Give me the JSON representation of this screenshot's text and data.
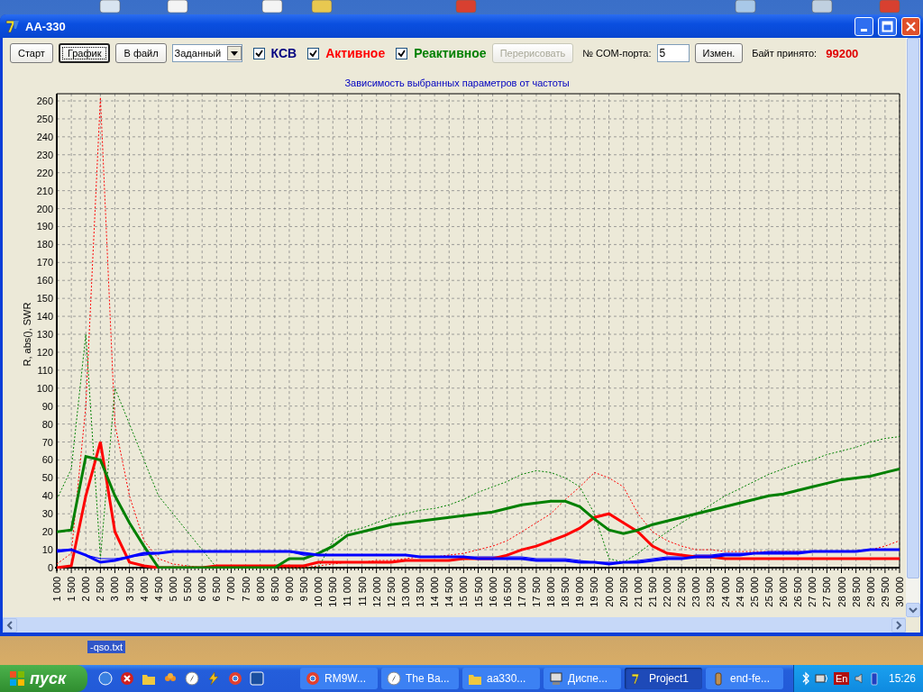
{
  "window": {
    "title": "AA-330"
  },
  "toolbar": {
    "items": [
      {
        "kind": "button",
        "label": "Старт",
        "focused": false,
        "disabled": false
      },
      {
        "kind": "button",
        "label": "График",
        "focused": true,
        "disabled": false
      },
      {
        "kind": "button",
        "label": "В файл",
        "focused": false,
        "disabled": false
      },
      {
        "kind": "dropdown",
        "value": "Заданный"
      },
      {
        "kind": "checkbox",
        "label": "КСВ",
        "checked": true,
        "color": "#000080"
      },
      {
        "kind": "checkbox",
        "label": "Активное",
        "checked": true,
        "color": "#ff0000"
      },
      {
        "kind": "checkbox",
        "label": "Реактивное",
        "checked": true,
        "color": "#008000"
      },
      {
        "kind": "button",
        "label": "Перерисовать",
        "focused": false,
        "disabled": true
      },
      {
        "kind": "label",
        "text": "№ COM-порта:"
      },
      {
        "kind": "input",
        "value": "5"
      },
      {
        "kind": "button",
        "label": "Измен.",
        "focused": false,
        "disabled": false
      },
      {
        "kind": "label",
        "text": "Байт принято:"
      },
      {
        "kind": "value",
        "text": "99200"
      }
    ]
  },
  "chart": {
    "chart_data": {
      "type": "line",
      "title": "Зависимость выбранных параметров от частоты",
      "ylabel": "R, abs(), SWR",
      "categories": [
        "1 000",
        "1 500",
        "2 000",
        "2 500",
        "3 000",
        "3 500",
        "4 000",
        "4 500",
        "5 000",
        "5 500",
        "6 000",
        "6 500",
        "7 000",
        "7 500",
        "8 000",
        "8 500",
        "9 000",
        "9 500",
        "10 000",
        "10 500",
        "11 000",
        "11 500",
        "12 000",
        "12 500",
        "13 000",
        "13 500",
        "14 000",
        "14 500",
        "15 000",
        "15 500",
        "16 000",
        "16 500",
        "17 000",
        "17 500",
        "18 000",
        "18 500",
        "19 000",
        "19 500",
        "20 000",
        "20 500",
        "21 000",
        "21 500",
        "22 000",
        "22 500",
        "23 000",
        "23 500",
        "24 000",
        "24 500",
        "25 000",
        "25 500",
        "26 000",
        "26 500",
        "27 000",
        "27 500",
        "28 000",
        "28 500",
        "29 000",
        "29 500",
        "30 000"
      ],
      "ylim": [
        0,
        264
      ],
      "grid": true,
      "yticks": [
        0,
        10,
        20,
        30,
        40,
        50,
        60,
        70,
        80,
        90,
        100,
        110,
        120,
        130,
        140,
        150,
        160,
        170,
        180,
        190,
        200,
        210,
        220,
        230,
        240,
        250,
        260
      ],
      "series": [
        {
          "line_style": "dashed",
          "color": "#ff0000",
          "values": [
            2,
            8,
            90,
            262,
            80,
            40,
            15,
            5,
            2,
            1,
            0,
            0,
            0,
            0,
            0,
            0,
            0,
            0,
            1,
            2,
            3,
            3,
            4,
            4,
            5,
            6,
            6,
            7,
            8,
            10,
            12,
            15,
            20,
            25,
            30,
            38,
            45,
            53,
            50,
            45,
            30,
            20,
            15,
            12,
            10,
            10,
            9,
            9,
            9,
            9,
            9,
            9,
            9,
            9,
            9,
            9,
            10,
            12,
            15
          ]
        },
        {
          "line_style": "dashed",
          "color": "#008000",
          "values": [
            38,
            55,
            130,
            5,
            100,
            80,
            60,
            40,
            30,
            20,
            10,
            0,
            0,
            0,
            0,
            0,
            0,
            0,
            0,
            15,
            20,
            22,
            25,
            28,
            30,
            32,
            33,
            35,
            38,
            42,
            45,
            48,
            52,
            54,
            53,
            50,
            45,
            30,
            5,
            3,
            8,
            14,
            20,
            25,
            30,
            35,
            40,
            44,
            48,
            52,
            55,
            58,
            60,
            63,
            65,
            67,
            70,
            72,
            73
          ]
        },
        {
          "line_style": "solid",
          "color": "#0000ff",
          "values": [
            10,
            10,
            7,
            5,
            5,
            6,
            7,
            8,
            9,
            9,
            9,
            9,
            9,
            9,
            9,
            9,
            9,
            7,
            7,
            7,
            7,
            7,
            7,
            7,
            7,
            6,
            6,
            6,
            6,
            6,
            6,
            6,
            6,
            5,
            5,
            5,
            4,
            3,
            3,
            3,
            4,
            5,
            6,
            6,
            7,
            7,
            8,
            8,
            8,
            9,
            9,
            9,
            9,
            9,
            9,
            9,
            10,
            10,
            10
          ]
        },
        {
          "line_style": "solid",
          "color": "#ff0000",
          "values": [
            0,
            1,
            40,
            70,
            20,
            3,
            1,
            0,
            0,
            0,
            0,
            1,
            1,
            1,
            1,
            1,
            1,
            1,
            3,
            3,
            3,
            3,
            3,
            3,
            4,
            4,
            4,
            4,
            5,
            5,
            5,
            7,
            10,
            12,
            15,
            18,
            22,
            28,
            30,
            25,
            20,
            12,
            8,
            7,
            6,
            6,
            5,
            5,
            5,
            5,
            5,
            5,
            5,
            5,
            5,
            5,
            5,
            5,
            5
          ]
        },
        {
          "line_style": "solid",
          "color": "#008000",
          "values": [
            20,
            21,
            62,
            60,
            40,
            25,
            12,
            0,
            0,
            0,
            0,
            0,
            0,
            0,
            0,
            0,
            5,
            5,
            8,
            12,
            18,
            20,
            22,
            24,
            25,
            26,
            27,
            28,
            29,
            30,
            31,
            33,
            35,
            36,
            37,
            37,
            34,
            27,
            21,
            19,
            21,
            24,
            26,
            28,
            30,
            32,
            34,
            36,
            38,
            40,
            41,
            43,
            45,
            47,
            49,
            50,
            51,
            53,
            55
          ]
        },
        {
          "line_style": "solid",
          "color": "#0000ff",
          "values": [
            9,
            10,
            7,
            3,
            4,
            6,
            8,
            8,
            9,
            9,
            9,
            9,
            9,
            9,
            9,
            9,
            9,
            8,
            7,
            7,
            7,
            7,
            7,
            7,
            7,
            6,
            6,
            6,
            6,
            5,
            5,
            5,
            5,
            4,
            4,
            4,
            3,
            3,
            2,
            3,
            3,
            4,
            5,
            5,
            6,
            6,
            7,
            7,
            8,
            8,
            8,
            8,
            9,
            9,
            9,
            9,
            10,
            10,
            10
          ]
        }
      ]
    }
  },
  "desktop": {
    "icon_label": "-qso.txt"
  },
  "taskbar": {
    "start": "пуск",
    "tasks": [
      {
        "label": "RM9W...",
        "selected": false
      },
      {
        "label": "The Ba...",
        "selected": false
      },
      {
        "label": "aa330...",
        "selected": false
      },
      {
        "label": "Диспе...",
        "selected": false
      },
      {
        "label": "Project1",
        "selected": true
      },
      {
        "label": "end-fe...",
        "selected": false
      }
    ],
    "language": "En",
    "clock": "15:26"
  }
}
